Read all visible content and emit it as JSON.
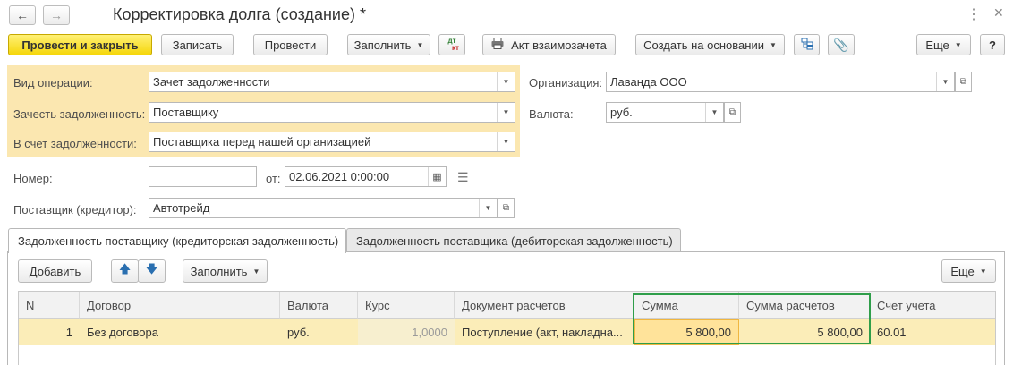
{
  "window": {
    "title": "Корректировка долга (создание) *",
    "back_icon": "←",
    "forward_icon": "→",
    "more_icon": "⋮",
    "close_icon": "✕"
  },
  "toolbar": {
    "post_and_close": "Провести и закрыть",
    "save": "Записать",
    "post": "Провести",
    "fill": "Заполнить",
    "dtkt_top": "дт",
    "dtkt_bottom": "кт",
    "act": "Акт взаимозачета",
    "create_based": "Создать на основании",
    "more": "Еще",
    "help": "?"
  },
  "form": {
    "operation_type": {
      "label": "Вид операции:",
      "value": "Зачет задолженности"
    },
    "offset_debt": {
      "label": "Зачесть задолженность:",
      "value": "Поставщику"
    },
    "against_debt": {
      "label": "В счет задолженности:",
      "value": "Поставщика перед нашей организацией"
    },
    "organization": {
      "label": "Организация:",
      "value": "Лаванда ООО"
    },
    "currency": {
      "label": "Валюта:",
      "value": "руб."
    },
    "number": {
      "label": "Номер:",
      "value": ""
    },
    "date": {
      "label": "от:",
      "value": "02.06.2021  0:00:00"
    },
    "supplier": {
      "label": "Поставщик (кредитор):",
      "value": "Автотрейд"
    }
  },
  "tabs": [
    {
      "label": "Задолженность поставщику (кредиторская задолженность)",
      "active": true
    },
    {
      "label": "Задолженность поставщика (дебиторская задолженность)",
      "active": false
    }
  ],
  "table_toolbar": {
    "add": "Добавить",
    "fill": "Заполнить",
    "more": "Еще"
  },
  "table": {
    "columns": [
      "N",
      "Договор",
      "Валюта",
      "Курс",
      "Документ расчетов",
      "Сумма",
      "Сумма расчетов",
      "Счет учета"
    ],
    "rows": [
      {
        "n": "1",
        "contract": "Без договора",
        "currency": "руб.",
        "rate": "1,0000",
        "document": "Поступление (акт, накладна...",
        "sum": "5 800,00",
        "settlement_sum": "5 800,00",
        "account": "60.01"
      }
    ]
  },
  "colors": {
    "primary_button": "#f5d60a",
    "highlight_group": "#fbe7b0",
    "selected_row": "#fbedb8",
    "green_frame": "#2f9e4a"
  }
}
